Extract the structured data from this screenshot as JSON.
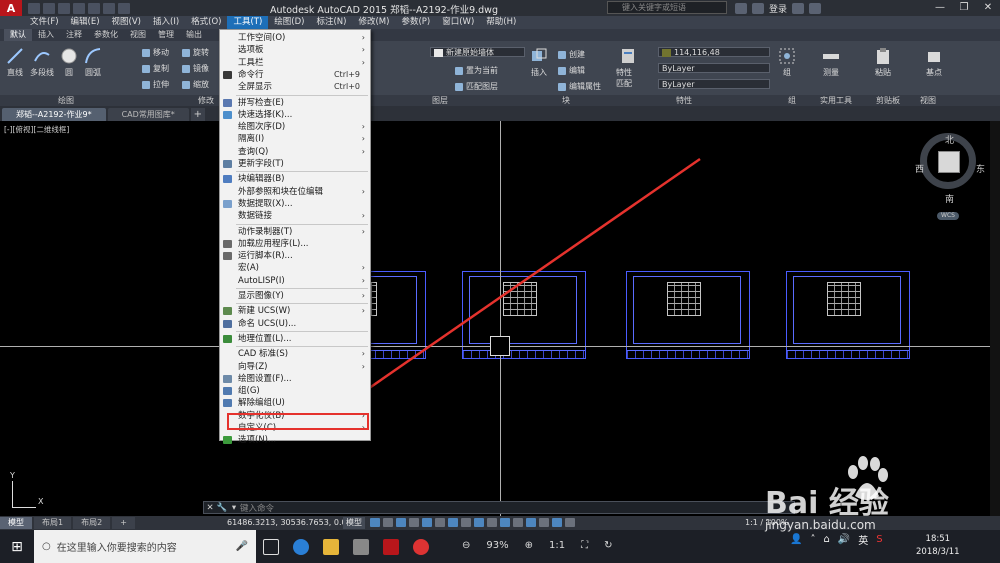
{
  "title": {
    "text": "Autodesk AutoCAD 2015    郑韬--A2192-作业9.dwg",
    "search_placeholder": "键入关键字或短语",
    "login": "登录"
  },
  "menubar": [
    "文件(F)",
    "编辑(E)",
    "视图(V)",
    "插入(I)",
    "格式(O)",
    "工具(T)",
    "绘图(D)",
    "标注(N)",
    "修改(M)",
    "参数(P)",
    "窗口(W)",
    "帮助(H)"
  ],
  "ribbon_tabs": [
    "默认",
    "插入",
    "注释",
    "参数化",
    "视图",
    "管理",
    "输出"
  ],
  "ribbon": {
    "draw_buttons": [
      "直线",
      "多段线",
      "圆",
      "圆弧"
    ],
    "modify_small": [
      "移动",
      "旋转",
      "复制",
      "镜像",
      "拉伸",
      "缩放"
    ],
    "layer_combo": "新建原始墙体",
    "layer_actions": [
      "置为当前",
      "匹配图层"
    ],
    "block_actions": [
      "创建",
      "编辑",
      "编辑属性"
    ],
    "insert_label": "插入",
    "match_label": "特性 匹配",
    "color_value": "114,116,48",
    "linetype": "ByLayer",
    "lineweight": "ByLayer",
    "group_label": "组",
    "measure_label": "测量",
    "paste_label": "粘贴",
    "base_label": "基点",
    "panel_labels": [
      "绘图",
      "修改",
      "图层",
      "块",
      "特性",
      "组",
      "实用工具",
      "剪贴板",
      "视图"
    ]
  },
  "doc_tabs": [
    "郑韬--A2192-作业9*",
    "CAD常用图库*"
  ],
  "viewport_label": "[-][俯视][二维线框]",
  "compass": {
    "north": "北",
    "south": "南",
    "east": "东",
    "west": "西",
    "wcs": "WCS"
  },
  "ucs": {
    "x": "X",
    "y": "Y"
  },
  "command_placeholder": "键入命令",
  "layout_tabs": [
    "模型",
    "布局1",
    "布局2"
  ],
  "status": {
    "coords": "61486.3213, 30536.7653, 0.0000",
    "model": "模型",
    "scale": "1:1 / 100%"
  },
  "tools_menu": [
    {
      "label": "工作空间(O)",
      "arrow": true
    },
    {
      "label": "选项板",
      "arrow": true
    },
    {
      "label": "工具栏",
      "arrow": true
    },
    {
      "label": "命令行",
      "shortcut": "Ctrl+9",
      "icon": "#3a3a3a"
    },
    {
      "label": "全屏显示",
      "shortcut": "Ctrl+0"
    },
    {
      "sep": true
    },
    {
      "label": "拼写检查(E)",
      "icon": "#5a78b0"
    },
    {
      "label": "快速选择(K)...",
      "icon": "#4d8fcc"
    },
    {
      "label": "绘图次序(D)",
      "arrow": true
    },
    {
      "label": "隔离(I)",
      "arrow": true
    },
    {
      "label": "查询(Q)",
      "arrow": true
    },
    {
      "label": "更新字段(T)",
      "icon": "#5e7fa3"
    },
    {
      "sep": true
    },
    {
      "label": "块编辑器(B)",
      "icon": "#4f7dc0"
    },
    {
      "label": "外部参照和块在位编辑",
      "arrow": true
    },
    {
      "label": "数据提取(X)...",
      "icon": "#7aa0cc"
    },
    {
      "label": "数据链接",
      "arrow": true
    },
    {
      "sep": true
    },
    {
      "label": "动作录制器(T)",
      "arrow": true
    },
    {
      "label": "加载应用程序(L)...",
      "icon": "#6a6a6a"
    },
    {
      "label": "运行脚本(R)...",
      "icon": "#6a6a6a"
    },
    {
      "label": "宏(A)",
      "arrow": true
    },
    {
      "label": "AutoLISP(I)",
      "arrow": true
    },
    {
      "sep": true
    },
    {
      "label": "显示图像(Y)",
      "arrow": true
    },
    {
      "sep": true
    },
    {
      "label": "新建 UCS(W)",
      "arrow": true,
      "icon": "#5d8a4e"
    },
    {
      "label": "命名 UCS(U)...",
      "icon": "#4f6f9f"
    },
    {
      "sep": true
    },
    {
      "label": "地理位置(L)...",
      "icon": "#3b8c3b"
    },
    {
      "sep": true
    },
    {
      "label": "CAD 标准(S)",
      "arrow": true
    },
    {
      "label": "向导(Z)",
      "arrow": true
    },
    {
      "label": "绘图设置(F)...",
      "icon": "#6d8aa8"
    },
    {
      "label": "组(G)",
      "icon": "#507ab0"
    },
    {
      "label": "解除编组(U)",
      "icon": "#507ab0"
    },
    {
      "label": "数字化仪(B)",
      "arrow": true
    },
    {
      "label": "自定义(C)",
      "arrow": true
    },
    {
      "label": "选项(N)...",
      "icon": "#3c9a3c"
    }
  ],
  "taskbar": {
    "search_placeholder": "在这里输入你要搜索的内容",
    "zoom": "93%",
    "ratio": "1:1",
    "ime": "英",
    "time": "18:51",
    "date": "2018/3/11"
  },
  "watermark": {
    "text": "Bai  经验",
    "url": "jingyan.baidu.com"
  }
}
